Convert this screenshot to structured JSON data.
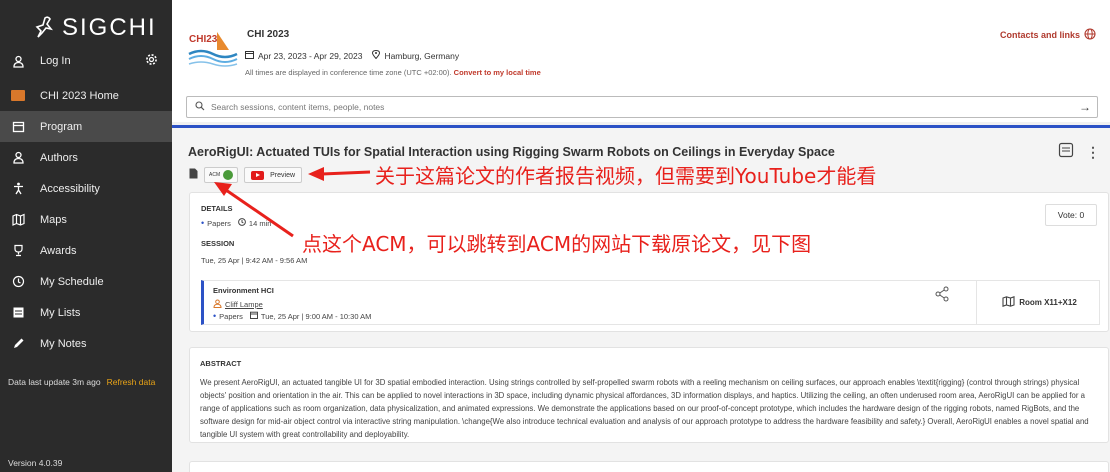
{
  "sidebar": {
    "logo_text": "SIGCHI",
    "login_label": "Log In",
    "items": [
      {
        "label": "CHI 2023 Home",
        "icon": "chi-logo-icon"
      },
      {
        "label": "Program",
        "icon": "calendar-icon"
      },
      {
        "label": "Authors",
        "icon": "person-icon"
      },
      {
        "label": "Accessibility",
        "icon": "accessibility-icon"
      },
      {
        "label": "Maps",
        "icon": "map-icon"
      },
      {
        "label": "Awards",
        "icon": "trophy-icon"
      },
      {
        "label": "My Schedule",
        "icon": "clock-icon"
      },
      {
        "label": "My Lists",
        "icon": "list-icon"
      },
      {
        "label": "My Notes",
        "icon": "pencil-icon"
      }
    ],
    "data_update": "Data last update 3m ago",
    "refresh_label": "Refresh data",
    "version": "Version 4.0.39"
  },
  "header": {
    "conf_logo_text": "CHI23",
    "conf_title": "CHI 2023",
    "dates": "Apr 23, 2023 - Apr 29, 2023",
    "location": "Hamburg, Germany",
    "tz_note": "All times are displayed in conference time zone (UTC +02:00).",
    "tz_link": "Convert to my local time",
    "contacts": "Contacts and links"
  },
  "search": {
    "placeholder": "Search sessions, content items, people, notes"
  },
  "paper": {
    "title": "AeroRigUI: Actuated TUIs for Spatial Interaction using Rigging Swarm Robots on Ceilings in Everyday Space",
    "acm_label": "ACM",
    "preview_label": "Preview",
    "details_label": "DETAILS",
    "type": "Papers",
    "duration": "14 min",
    "session_label": "SESSION",
    "session_time": "Tue, 25 Apr | 9:42 AM - 9:56 AM",
    "vote": "Vote: 0",
    "session_name": "Environment HCI",
    "chair": "Cliff Lampe",
    "session_type": "Papers",
    "session_slot": "Tue, 25 Apr | 9:00 AM - 10:30 AM",
    "room": "Room X11+X12",
    "abstract_label": "ABSTRACT",
    "abstract": "We present AeroRigUI, an actuated tangible UI for 3D spatial embodied interaction. Using strings controlled by self-propelled swarm robots with a reeling mechanism on ceiling surfaces, our approach enables \\textit{rigging} (control through strings) physical objects' position and orientation in the air. This can be applied to novel interactions in 3D space, including dynamic physical affordances, 3D information displays, and haptics. Utilizing the ceiling, an often underused room area, AeroRigUI can be applied for a range of applications such as room organization, data physicalization, and animated expressions. We demonstrate the applications based on our proof-of-concept prototype, which includes the hardware design of the rigging robots, named RigBots, and the software design for mid-air object control via interactive string manipulation. \\change{We also introduce technical evaluation and analysis of our approach prototype to address the hardware feasibility and safety.} Overall, AeroRigUI enables a novel spatial and tangible UI system with great controllability and deployability."
  },
  "annotations": {
    "video_note": "关于这篇论文的作者报告视频，但需要到YouTube才能看",
    "acm_note": "点这个ACM，可以跳转到ACM的网站下载原论文，见下图"
  },
  "colors": {
    "sidebar": "#2b2b2b",
    "accent_blue": "#2c52c6",
    "annotation_red": "#e8211c",
    "link_red": "#c0392b"
  }
}
